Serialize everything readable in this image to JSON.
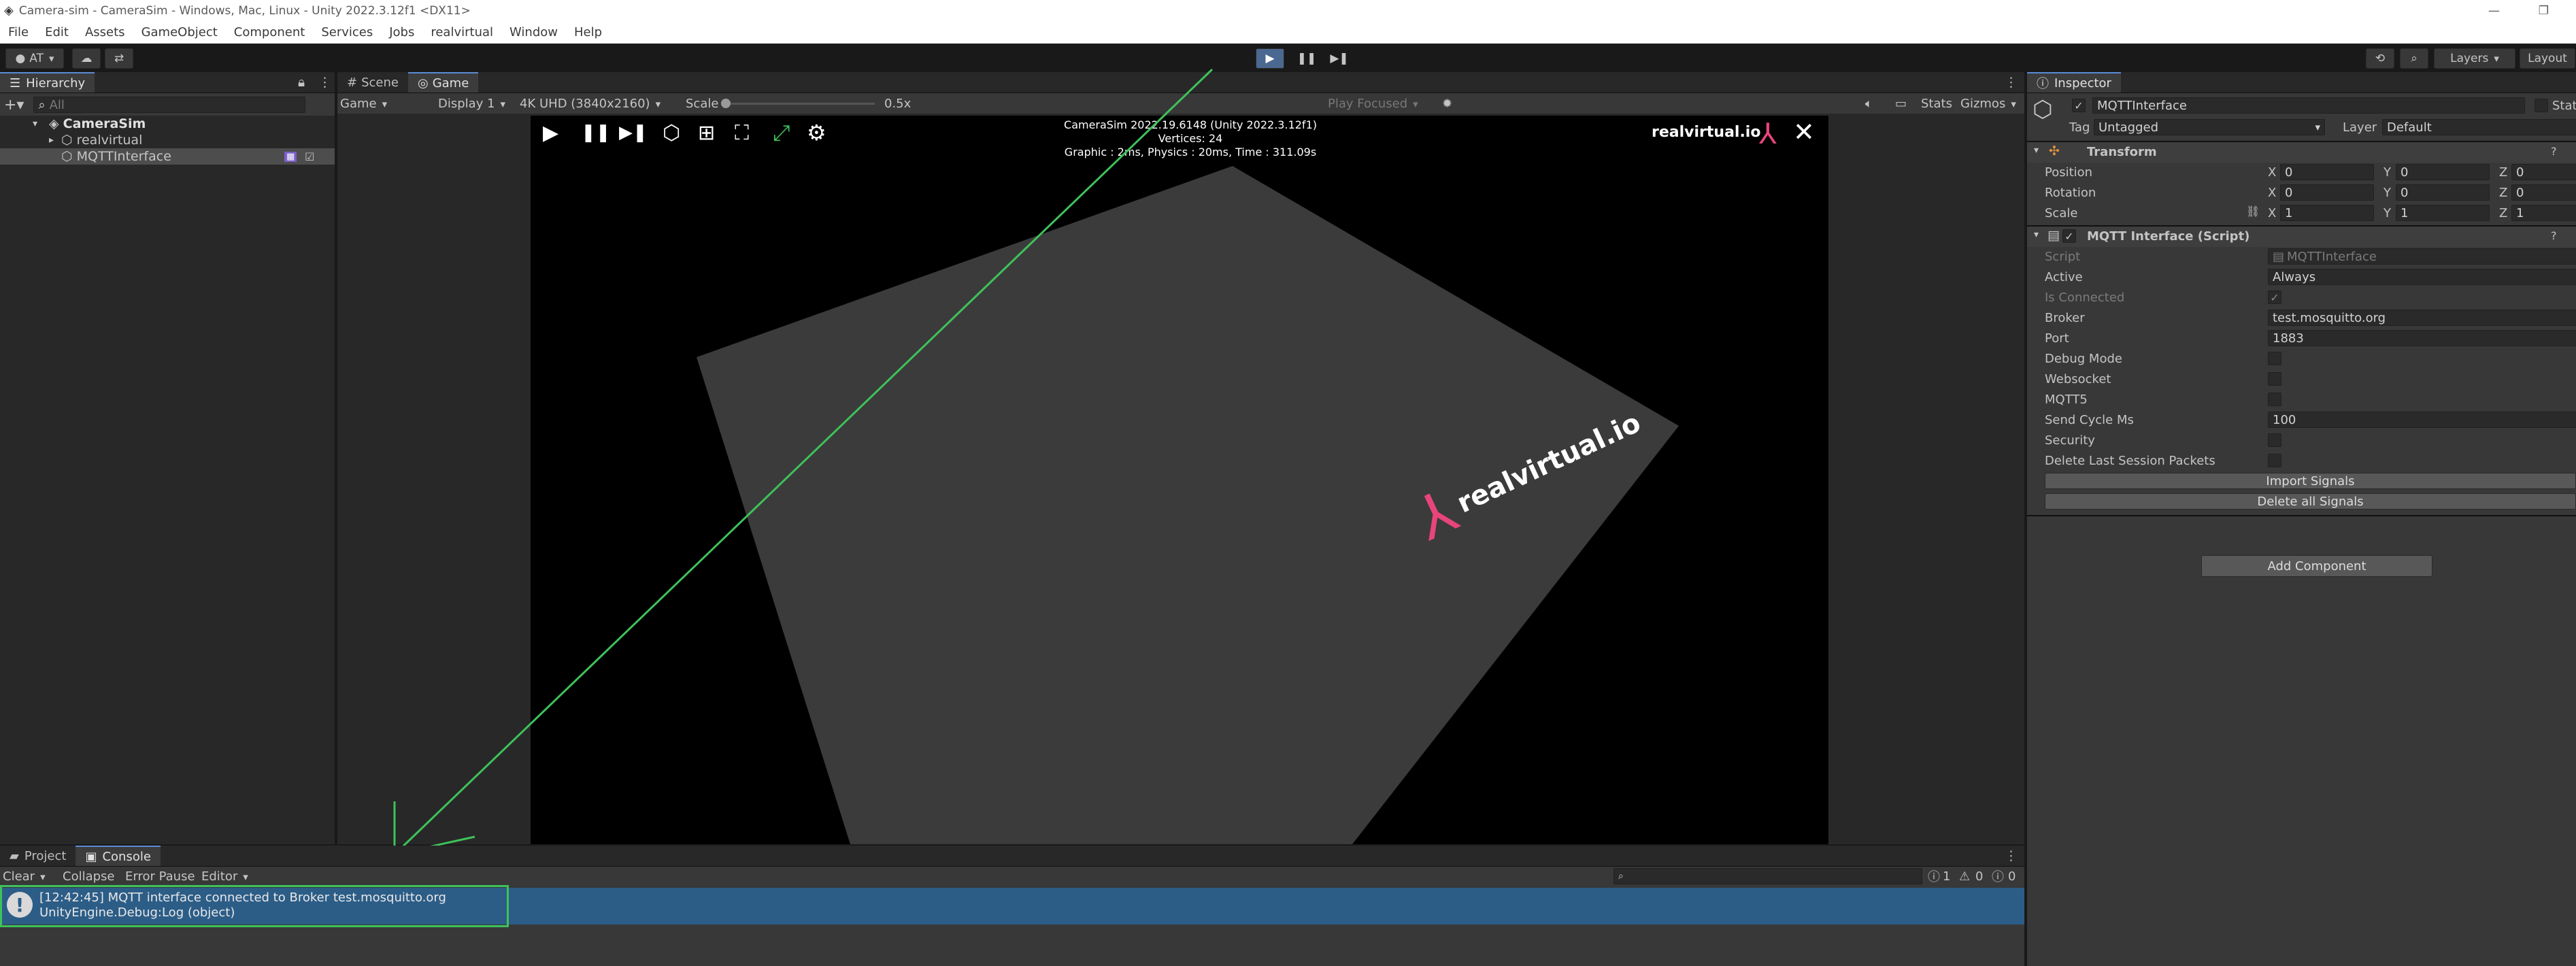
{
  "window": {
    "title": "Camera-sim - CameraSim - Windows, Mac, Linux - Unity 2022.3.12f1 <DX11>",
    "controls": [
      "—",
      "❐"
    ]
  },
  "menubar": [
    "File",
    "Edit",
    "Assets",
    "GameObject",
    "Component",
    "Services",
    "Jobs",
    "realvirtual",
    "Window",
    "Help"
  ],
  "toolbar": {
    "account": "AT",
    "layers_label": "Layers",
    "layout_label": "Layout",
    "play_icon": "play-icon",
    "pause_icon": "pause-icon",
    "step_icon": "step-icon"
  },
  "hierarchy": {
    "tab": "Hierarchy",
    "search_placeholder": "All",
    "scene": "CameraSim",
    "items": [
      "realvirtual",
      "MQTTInterface"
    ]
  },
  "game_view": {
    "tabs": [
      "Scene",
      "Game"
    ],
    "mode": "Game",
    "display": "Display 1",
    "resolution": "4K UHD (3840x2160)",
    "scale_label": "Scale",
    "scale_value": "0.5x",
    "play_focused": "Play Focused",
    "stats": "Stats",
    "gizmos": "Gizmos",
    "overlay": {
      "line1": "CameraSim 2022.19.6148 (Unity 2022.3.12f1)",
      "line2": "Vertices: 24",
      "line3": "Graphic : 2ms, Physics : 20ms, Time : 311.09s"
    },
    "brand": "realvirtual.io",
    "floor_brand": "realvirtual.io",
    "accent": "#e8457a"
  },
  "inspector": {
    "tab": "Inspector",
    "object_name": "MQTTInterface",
    "static_label": "Stat",
    "tag_label": "Tag",
    "tag_value": "Untagged",
    "layer_label": "Layer",
    "layer_value": "Default",
    "transform": {
      "title": "Transform",
      "rows": [
        {
          "label": "Position",
          "x": "0",
          "y": "0",
          "z": "0"
        },
        {
          "label": "Rotation",
          "x": "0",
          "y": "0",
          "z": "0"
        },
        {
          "label": "Scale",
          "x": "1",
          "y": "1",
          "z": "1"
        }
      ]
    },
    "script_component": {
      "title": "MQTT Interface (Script)",
      "script_label": "Script",
      "script_value": "MQTTInterface",
      "active_label": "Active",
      "active_value": "Always",
      "is_connected_label": "Is Connected",
      "broker_label": "Broker",
      "broker_value": "test.mosquitto.org",
      "port_label": "Port",
      "port_value": "1883",
      "debug_label": "Debug Mode",
      "websocket_label": "Websocket",
      "mqtt5_label": "MQTT5",
      "send_cycle_label": "Send Cycle Ms",
      "send_cycle_value": "100",
      "security_label": "Security",
      "delete_last_label": "Delete Last Session Packets",
      "import_button": "Import Signals",
      "delete_all_button": "Delete all Signals"
    },
    "add_component": "Add Component"
  },
  "console": {
    "tabs": [
      "Project",
      "Console"
    ],
    "clear": "Clear",
    "collapse": "Collapse",
    "error_pause": "Error Pause",
    "editor": "Editor",
    "counts": {
      "log": "1",
      "warn": "0",
      "error": "0"
    },
    "entry_line1": "[12:42:45] MQTT interface connected to Broker test.mosquitto.org",
    "entry_line2": "UnityEngine.Debug:Log (object)"
  }
}
